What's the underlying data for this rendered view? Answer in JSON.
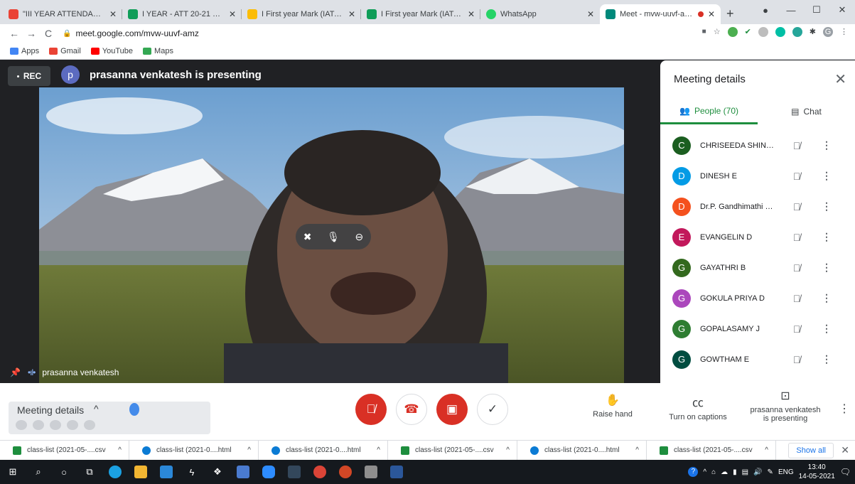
{
  "browser": {
    "tabs": [
      {
        "title": "\"III YEAR ATTENDANCE\" - g",
        "favicon_color": "#ea4335",
        "active": false
      },
      {
        "title": "I YEAR - ATT 20-21 EVEN-V",
        "favicon_color": "#0f9d58",
        "active": false
      },
      {
        "title": "I First year Mark (IAT-1).xlsx",
        "favicon_color": "#fbbc04",
        "active": false
      },
      {
        "title": "I First year Mark (IAT-1).xlsx",
        "favicon_color": "#0f9d58",
        "active": false
      },
      {
        "title": "WhatsApp",
        "favicon_color": "#25d366",
        "active": false
      },
      {
        "title": "Meet - mvw-uuvf-amz",
        "favicon_color": "#00897b",
        "active": true
      }
    ],
    "url": "meet.google.com/mvw-uuvf-amz",
    "bookmarks": [
      {
        "label": "Apps",
        "color": "#4285f4"
      },
      {
        "label": "Gmail",
        "color": "#ea4335"
      },
      {
        "label": "YouTube",
        "color": "#ff0000"
      },
      {
        "label": "Maps",
        "color": "#34a853"
      }
    ],
    "profile_initial": "G"
  },
  "meet": {
    "rec_label": "REC",
    "presenter_initial": "p",
    "presenting_title": "prasanna venkatesh is presenting",
    "tile_name": "prasanna venkatesh",
    "panel": {
      "title": "Meeting details",
      "people_tab": "People (70)",
      "chat_tab": "Chat",
      "participants": [
        {
          "initial": "C",
          "name": "CHRISEEDA SHINNY P",
          "color": "#1b5e20"
        },
        {
          "initial": "D",
          "name": "DINESH E",
          "color": "#039be5"
        },
        {
          "initial": "D",
          "name": "Dr.P. Gandhimathi H AN...",
          "color": "#f4511e"
        },
        {
          "initial": "E",
          "name": "EVANGELIN D",
          "color": "#c2185b"
        },
        {
          "initial": "G",
          "name": "GAYATHRI B",
          "color": "#33691e"
        },
        {
          "initial": "G",
          "name": "GOKULA PRIYA D",
          "color": "#ab47bc"
        },
        {
          "initial": "G",
          "name": "GOPALASAMY J",
          "color": "#2e7d32"
        },
        {
          "initial": "G",
          "name": "GOWTHAM E",
          "color": "#004d40"
        }
      ]
    },
    "bottom": {
      "meeting_details": "Meeting details",
      "raise_hand": "Raise hand",
      "captions": "Turn on captions",
      "presenting_line1": "prasanna venkatesh",
      "presenting_line2": "is presenting"
    }
  },
  "downloads": {
    "items": [
      {
        "name": "class-list (2021-05-....csv",
        "kind": "csv"
      },
      {
        "name": "class-list (2021-0....html",
        "kind": "html"
      },
      {
        "name": "class-list (2021-0....html",
        "kind": "html"
      },
      {
        "name": "class-list (2021-05-....csv",
        "kind": "csv"
      },
      {
        "name": "class-list (2021-0....html",
        "kind": "html"
      },
      {
        "name": "class-list (2021-05-....csv",
        "kind": "csv"
      }
    ],
    "show_all": "Show all"
  },
  "taskbar": {
    "lang": "ENG",
    "time": "13:40",
    "date": "14-05-2021",
    "notification_count": "2"
  }
}
